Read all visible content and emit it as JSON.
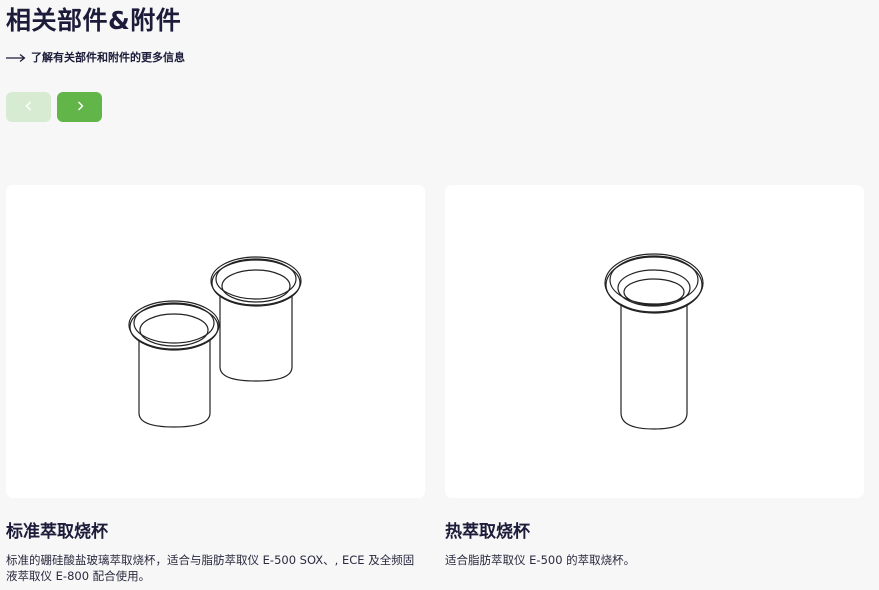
{
  "section": {
    "title": "相关部件&附件",
    "more_link": "了解有关部件和附件的更多信息"
  },
  "icons": {
    "more_link": "arrow-right-icon",
    "prev": "chevron-left-icon",
    "next": "chevron-right-icon"
  },
  "colors": {
    "accent": "#62b548",
    "accent_disabled": "#d7ebd3",
    "text": "#1c1c3a",
    "background": "#f7f7f7",
    "card": "#ffffff"
  },
  "products": [
    {
      "title": "标准萃取烧杯",
      "description": "标准的硼硅酸盐玻璃萃取烧杯，适合与脂肪萃取仪 E-500 SOX、, ECE 及全频固液萃取仪 E-800 配合使用。"
    },
    {
      "title": "热萃取烧杯",
      "description": "适合脂肪萃取仪 E-500 的萃取烧杯。"
    }
  ]
}
